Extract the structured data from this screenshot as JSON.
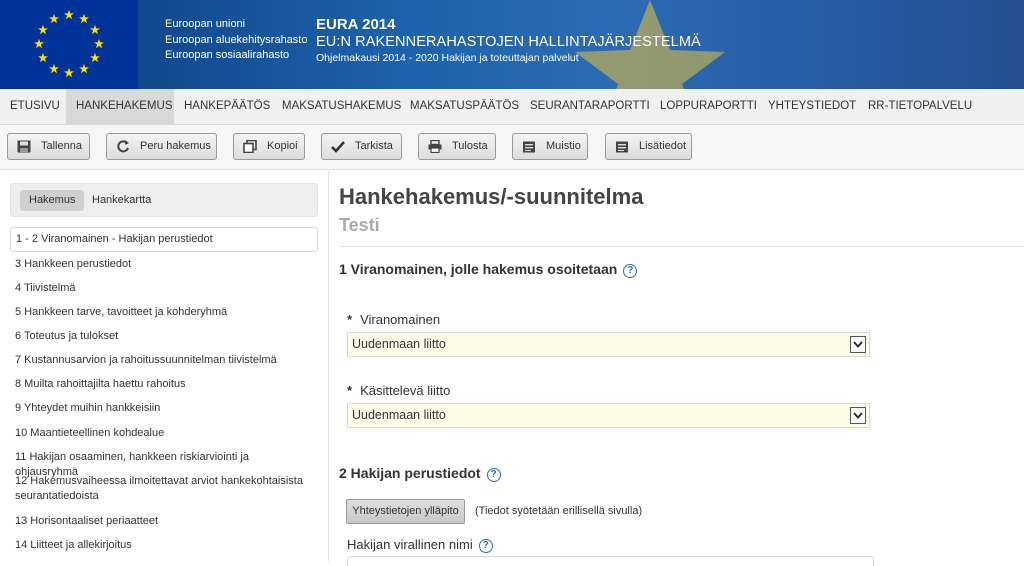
{
  "header": {
    "funds": [
      "Euroopan unioni",
      "Euroopan aluekehitysrahasto",
      "Euroopan sosiaalirahasto"
    ],
    "system_name": "EURA 2014",
    "system_title": "EU:N RAKENNERAHASTOJEN HALLINTAJÄRJESTELMÄ",
    "system_subtitle": "Ohjelmakausi 2014 - 2020 Hakijan ja toteuttajan palvelut"
  },
  "nav": [
    "ETUSIVU",
    "HANKEHAKEMUS",
    "HANKEPÄÄTÖS",
    "MAKSATUSHAKEMUS",
    "MAKSATUSPÄÄTÖS",
    "SEURANTARAPORTTI",
    "LOPPURAPORTTI",
    "YHTEYSTIEDOT",
    "RR-TIETOPALVELU"
  ],
  "nav_active": "HANKEHAKEMUS",
  "toolbar": {
    "save": "Tallenna",
    "cancel": "Peru hakemus",
    "copy": "Kopioi",
    "check": "Tarkista",
    "print": "Tulosta",
    "memo": "Muistio",
    "info": "Lisätiedot"
  },
  "sidebar": {
    "tabs": [
      "Hakemus",
      "Hankekartta"
    ],
    "items": [
      "1 - 2 Viranomainen - Hakijan perustiedot",
      "3 Hankkeen perustiedot",
      "4 Tiivistelmä",
      "5 Hankkeen tarve, tavoitteet ja kohderyhmä",
      "6 Toteutus ja tulokset",
      "7 Kustannusarvion ja rahoitussuunnitelman tiivistelmä",
      "8 Muilta rahoittajilta haettu rahoitus",
      "9 Yhteydet muihin hankkeisiin",
      "10 Maantieteellinen kohdealue",
      "11 Hakijan osaaminen, hankkeen riskiarviointi ja ohjausryhmä",
      "12 Hakemusvaiheessa ilmoitettavat arviot hankekohtaisista",
      "seurantatiedoista",
      "13 Horisontaaliset periaatteet",
      "14 Liitteet ja allekirjoitus"
    ]
  },
  "main": {
    "title": "Hankehakemus/-suunnitelma",
    "subtitle": "Testi",
    "section1": "1 Viranomainen, jolle hakemus osoitetaan",
    "authority_label": "Viranomainen",
    "authority_value": "Uudenmaan liitto",
    "handler_label": "Käsittelevä liitto",
    "handler_value": "Uudenmaan liitto",
    "required_mark": "*",
    "section2": "2 Hakijan perustiedot",
    "contact_button": "Yhteystietojen ylläpito",
    "contact_note": "(Tiedot syötetään erillisellä sivulla)",
    "official_name_label": "Hakijan virallinen nimi",
    "help_glyph": "?"
  }
}
